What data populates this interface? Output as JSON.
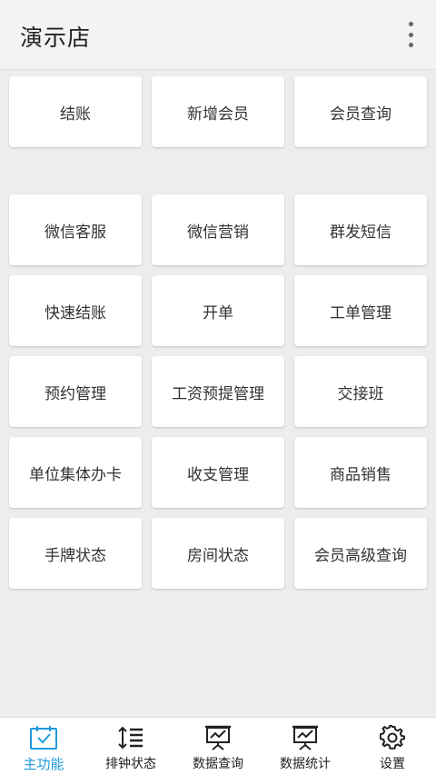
{
  "header": {
    "title": "演示店"
  },
  "grid": {
    "row0": [
      "结账",
      "新增会员",
      "会员查询"
    ],
    "row1": [
      "微信客服",
      "微信营销",
      "群发短信"
    ],
    "row2": [
      "快速结账",
      "开单",
      "工单管理"
    ],
    "row3": [
      "预约管理",
      "工资预提管理",
      "交接班"
    ],
    "row4": [
      "单位集体办卡",
      "收支管理",
      "商品销售"
    ],
    "row5": [
      "手牌状态",
      "房间状态",
      "会员高级查询"
    ]
  },
  "tabs": [
    {
      "label": "主功能",
      "icon": "calendar-check-icon"
    },
    {
      "label": "排钟状态",
      "icon": "sort-list-icon"
    },
    {
      "label": "数据查询",
      "icon": "presentation-chart-icon"
    },
    {
      "label": "数据统计",
      "icon": "presentation-chart-icon"
    },
    {
      "label": "设置",
      "icon": "gear-icon"
    }
  ],
  "colors": {
    "accent": "#1e9bdb",
    "background": "#ededed",
    "tile": "#ffffff"
  }
}
